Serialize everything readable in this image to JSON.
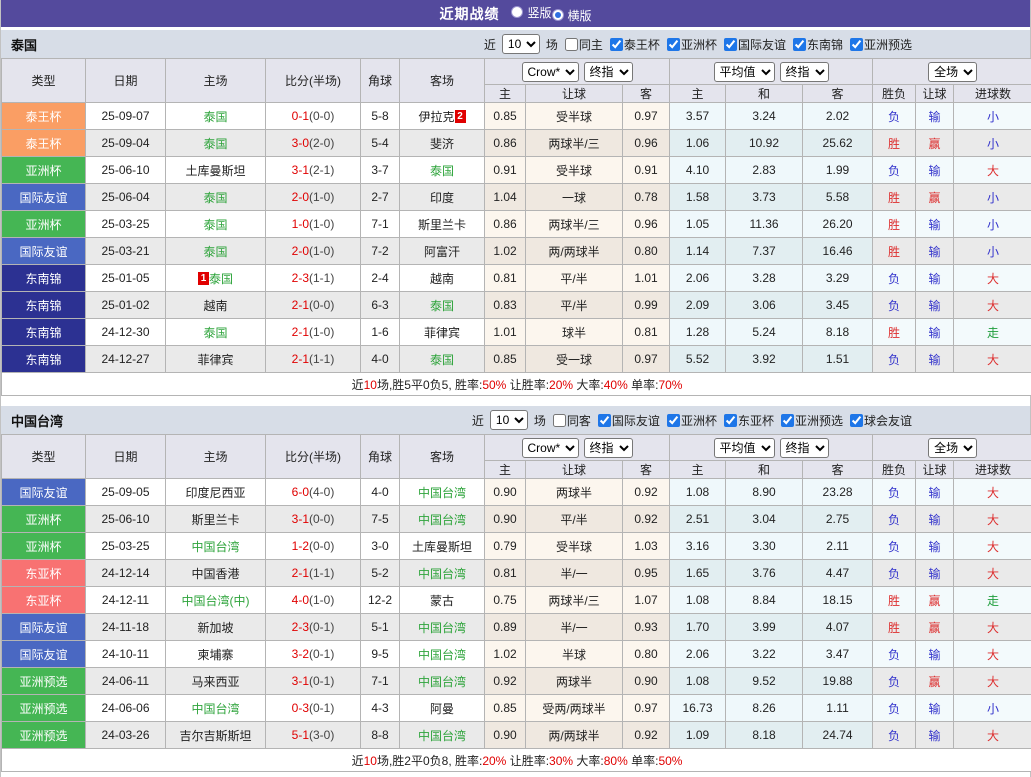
{
  "topbar": {
    "title": "近期战绩",
    "radios": [
      {
        "label": "竖版",
        "checked": false
      },
      {
        "label": "横版",
        "checked": true
      }
    ]
  },
  "table_header": {
    "group_cols": [
      "类型",
      "日期",
      "主场",
      "比分(半场)",
      "角球",
      "客场"
    ],
    "sub_cols": [
      "主",
      "让球",
      "客",
      "主",
      "和",
      "客",
      "胜负",
      "让球",
      "进球数"
    ],
    "selects": {
      "bookmaker": "Crow*",
      "final1": "终指",
      "average": "平均值",
      "final2": "终指",
      "scope": "全场"
    }
  },
  "league_colors": {
    "泰王杯": "#FA9E64",
    "亚洲杯": "#45B654",
    "国际友谊": "#4A68C2",
    "东南锦": "#2C3192",
    "东亚杯": "#F87272",
    "亚洲预选": "#45B654"
  },
  "result_colors": {
    "胜": "#DD2F2F",
    "赢": "#DD2F2F",
    "大": "#DD2F2F",
    "负": "#3333CC",
    "输": "#3333CC",
    "小": "#3333CC",
    "走": "#1F9E3C"
  },
  "sections": [
    {
      "label": "泰国",
      "filters": {
        "prefix": "近",
        "count": "10",
        "suffix": "场",
        "same_option": {
          "label": "同主",
          "checked": false
        },
        "leagues": [
          {
            "label": "泰王杯",
            "checked": true
          },
          {
            "label": "亚洲杯",
            "checked": true
          },
          {
            "label": "国际友谊",
            "checked": true
          },
          {
            "label": "东南锦",
            "checked": true
          },
          {
            "label": "亚洲预选",
            "checked": true
          }
        ]
      },
      "rows": [
        {
          "league": "泰王杯",
          "date": "25-09-07",
          "home": {
            "text": "泰国",
            "green": true,
            "rank": ""
          },
          "score": "0-1",
          "half": "(0-0)",
          "corner": "5-8",
          "away": {
            "text": "伊拉克",
            "green": false,
            "rank": "2"
          },
          "crow": [
            "0.85",
            "受半球",
            "0.97"
          ],
          "avg": [
            "3.57",
            "3.24",
            "2.02"
          ],
          "res": [
            "负",
            "输",
            "小"
          ]
        },
        {
          "league": "泰王杯",
          "date": "25-09-04",
          "home": {
            "text": "泰国",
            "green": true,
            "rank": ""
          },
          "score": "3-0",
          "half": "(2-0)",
          "corner": "5-4",
          "away": {
            "text": "斐济",
            "green": false,
            "rank": ""
          },
          "crow": [
            "0.86",
            "两球半/三",
            "0.96"
          ],
          "avg": [
            "1.06",
            "10.92",
            "25.62"
          ],
          "res": [
            "胜",
            "赢",
            "小"
          ]
        },
        {
          "league": "亚洲杯",
          "date": "25-06-10",
          "home": {
            "text": "土库曼斯坦",
            "green": false,
            "rank": ""
          },
          "score": "3-1",
          "half": "(2-1)",
          "corner": "3-7",
          "away": {
            "text": "泰国",
            "green": true,
            "rank": ""
          },
          "crow": [
            "0.91",
            "受半球",
            "0.91"
          ],
          "avg": [
            "4.10",
            "2.83",
            "1.99"
          ],
          "res": [
            "负",
            "输",
            "大"
          ]
        },
        {
          "league": "国际友谊",
          "date": "25-06-04",
          "home": {
            "text": "泰国",
            "green": true,
            "rank": ""
          },
          "score": "2-0",
          "half": "(1-0)",
          "corner": "2-7",
          "away": {
            "text": "印度",
            "green": false,
            "rank": ""
          },
          "crow": [
            "1.04",
            "一球",
            "0.78"
          ],
          "avg": [
            "1.58",
            "3.73",
            "5.58"
          ],
          "res": [
            "胜",
            "赢",
            "小"
          ]
        },
        {
          "league": "亚洲杯",
          "date": "25-03-25",
          "home": {
            "text": "泰国",
            "green": true,
            "rank": ""
          },
          "score": "1-0",
          "half": "(1-0)",
          "corner": "7-1",
          "away": {
            "text": "斯里兰卡",
            "green": false,
            "rank": ""
          },
          "crow": [
            "0.86",
            "两球半/三",
            "0.96"
          ],
          "avg": [
            "1.05",
            "11.36",
            "26.20"
          ],
          "res": [
            "胜",
            "输",
            "小"
          ]
        },
        {
          "league": "国际友谊",
          "date": "25-03-21",
          "home": {
            "text": "泰国",
            "green": true,
            "rank": ""
          },
          "score": "2-0",
          "half": "(1-0)",
          "corner": "7-2",
          "away": {
            "text": "阿富汗",
            "green": false,
            "rank": ""
          },
          "crow": [
            "1.02",
            "两/两球半",
            "0.80"
          ],
          "avg": [
            "1.14",
            "7.37",
            "16.46"
          ],
          "res": [
            "胜",
            "输",
            "小"
          ]
        },
        {
          "league": "东南锦",
          "date": "25-01-05",
          "home": {
            "text": "泰国",
            "green": true,
            "rank": "1"
          },
          "score": "2-3",
          "half": "(1-1)",
          "corner": "2-4",
          "away": {
            "text": "越南",
            "green": false,
            "rank": ""
          },
          "crow": [
            "0.81",
            "平/半",
            "1.01"
          ],
          "avg": [
            "2.06",
            "3.28",
            "3.29"
          ],
          "res": [
            "负",
            "输",
            "大"
          ]
        },
        {
          "league": "东南锦",
          "date": "25-01-02",
          "home": {
            "text": "越南",
            "green": false,
            "rank": ""
          },
          "score": "2-1",
          "half": "(0-0)",
          "corner": "6-3",
          "away": {
            "text": "泰国",
            "green": true,
            "rank": ""
          },
          "crow": [
            "0.83",
            "平/半",
            "0.99"
          ],
          "avg": [
            "2.09",
            "3.06",
            "3.45"
          ],
          "res": [
            "负",
            "输",
            "大"
          ]
        },
        {
          "league": "东南锦",
          "date": "24-12-30",
          "home": {
            "text": "泰国",
            "green": true,
            "rank": ""
          },
          "score": "2-1",
          "half": "(1-0)",
          "corner": "1-6",
          "away": {
            "text": "菲律宾",
            "green": false,
            "rank": ""
          },
          "crow": [
            "1.01",
            "球半",
            "0.81"
          ],
          "avg": [
            "1.28",
            "5.24",
            "8.18"
          ],
          "res": [
            "胜",
            "输",
            "走"
          ]
        },
        {
          "league": "东南锦",
          "date": "24-12-27",
          "home": {
            "text": "菲律宾",
            "green": false,
            "rank": ""
          },
          "score": "2-1",
          "half": "(1-1)",
          "corner": "4-0",
          "away": {
            "text": "泰国",
            "green": true,
            "rank": ""
          },
          "crow": [
            "0.85",
            "受一球",
            "0.97"
          ],
          "avg": [
            "5.52",
            "3.92",
            "1.51"
          ],
          "res": [
            "负",
            "输",
            "大"
          ]
        }
      ],
      "summary": [
        {
          "text": "近",
          "red": false
        },
        {
          "text": "10",
          "red": true
        },
        {
          "text": "场,胜5平0负5, 胜率:",
          "red": false
        },
        {
          "text": "50%",
          "red": true
        },
        {
          "text": " 让胜率:",
          "red": false
        },
        {
          "text": "20%",
          "red": true
        },
        {
          "text": " 大率:",
          "red": false
        },
        {
          "text": "40%",
          "red": true
        },
        {
          "text": " 单率:",
          "red": false
        },
        {
          "text": "70%",
          "red": true
        }
      ]
    },
    {
      "label": "中国台湾",
      "filters": {
        "prefix": "近",
        "count": "10",
        "suffix": "场",
        "same_option": {
          "label": "同客",
          "checked": false
        },
        "leagues": [
          {
            "label": "国际友谊",
            "checked": true
          },
          {
            "label": "亚洲杯",
            "checked": true
          },
          {
            "label": "东亚杯",
            "checked": true
          },
          {
            "label": "亚洲预选",
            "checked": true
          },
          {
            "label": "球会友谊",
            "checked": true
          }
        ]
      },
      "rows": [
        {
          "league": "国际友谊",
          "date": "25-09-05",
          "home": {
            "text": "印度尼西亚",
            "green": false,
            "rank": ""
          },
          "score": "6-0",
          "half": "(4-0)",
          "corner": "4-0",
          "away": {
            "text": "中国台湾",
            "green": true,
            "rank": ""
          },
          "crow": [
            "0.90",
            "两球半",
            "0.92"
          ],
          "avg": [
            "1.08",
            "8.90",
            "23.28"
          ],
          "res": [
            "负",
            "输",
            "大"
          ]
        },
        {
          "league": "亚洲杯",
          "date": "25-06-10",
          "home": {
            "text": "斯里兰卡",
            "green": false,
            "rank": ""
          },
          "score": "3-1",
          "half": "(0-0)",
          "corner": "7-5",
          "away": {
            "text": "中国台湾",
            "green": true,
            "rank": ""
          },
          "crow": [
            "0.90",
            "平/半",
            "0.92"
          ],
          "avg": [
            "2.51",
            "3.04",
            "2.75"
          ],
          "res": [
            "负",
            "输",
            "大"
          ]
        },
        {
          "league": "亚洲杯",
          "date": "25-03-25",
          "home": {
            "text": "中国台湾",
            "green": true,
            "rank": ""
          },
          "score": "1-2",
          "half": "(0-0)",
          "corner": "3-0",
          "away": {
            "text": "土库曼斯坦",
            "green": false,
            "rank": ""
          },
          "crow": [
            "0.79",
            "受半球",
            "1.03"
          ],
          "avg": [
            "3.16",
            "3.30",
            "2.11"
          ],
          "res": [
            "负",
            "输",
            "大"
          ]
        },
        {
          "league": "东亚杯",
          "date": "24-12-14",
          "home": {
            "text": "中国香港",
            "green": false,
            "rank": ""
          },
          "score": "2-1",
          "half": "(1-1)",
          "corner": "5-2",
          "away": {
            "text": "中国台湾",
            "green": true,
            "rank": ""
          },
          "crow": [
            "0.81",
            "半/一",
            "0.95"
          ],
          "avg": [
            "1.65",
            "3.76",
            "4.47"
          ],
          "res": [
            "负",
            "输",
            "大"
          ]
        },
        {
          "league": "东亚杯",
          "date": "24-12-11",
          "home": {
            "text": "中国台湾(中)",
            "green": true,
            "rank": ""
          },
          "score": "4-0",
          "half": "(1-0)",
          "corner": "12-2",
          "away": {
            "text": "蒙古",
            "green": false,
            "rank": ""
          },
          "crow": [
            "0.75",
            "两球半/三",
            "1.07"
          ],
          "avg": [
            "1.08",
            "8.84",
            "18.15"
          ],
          "res": [
            "胜",
            "赢",
            "走"
          ]
        },
        {
          "league": "国际友谊",
          "date": "24-11-18",
          "home": {
            "text": "新加坡",
            "green": false,
            "rank": ""
          },
          "score": "2-3",
          "half": "(0-1)",
          "corner": "5-1",
          "away": {
            "text": "中国台湾",
            "green": true,
            "rank": ""
          },
          "crow": [
            "0.89",
            "半/一",
            "0.93"
          ],
          "avg": [
            "1.70",
            "3.99",
            "4.07"
          ],
          "res": [
            "胜",
            "赢",
            "大"
          ]
        },
        {
          "league": "国际友谊",
          "date": "24-10-11",
          "home": {
            "text": "柬埔寨",
            "green": false,
            "rank": ""
          },
          "score": "3-2",
          "half": "(0-1)",
          "corner": "9-5",
          "away": {
            "text": "中国台湾",
            "green": true,
            "rank": ""
          },
          "crow": [
            "1.02",
            "半球",
            "0.80"
          ],
          "avg": [
            "2.06",
            "3.22",
            "3.47"
          ],
          "res": [
            "负",
            "输",
            "大"
          ]
        },
        {
          "league": "亚洲预选",
          "date": "24-06-11",
          "home": {
            "text": "马来西亚",
            "green": false,
            "rank": ""
          },
          "score": "3-1",
          "half": "(0-1)",
          "corner": "7-1",
          "away": {
            "text": "中国台湾",
            "green": true,
            "rank": ""
          },
          "crow": [
            "0.92",
            "两球半",
            "0.90"
          ],
          "avg": [
            "1.08",
            "9.52",
            "19.88"
          ],
          "res": [
            "负",
            "赢",
            "大"
          ]
        },
        {
          "league": "亚洲预选",
          "date": "24-06-06",
          "home": {
            "text": "中国台湾",
            "green": true,
            "rank": ""
          },
          "score": "0-3",
          "half": "(0-1)",
          "corner": "4-3",
          "away": {
            "text": "阿曼",
            "green": false,
            "rank": ""
          },
          "crow": [
            "0.85",
            "受两/两球半",
            "0.97"
          ],
          "avg": [
            "16.73",
            "8.26",
            "1.11"
          ],
          "res": [
            "负",
            "输",
            "小"
          ]
        },
        {
          "league": "亚洲预选",
          "date": "24-03-26",
          "home": {
            "text": "吉尔吉斯斯坦",
            "green": false,
            "rank": ""
          },
          "score": "5-1",
          "half": "(3-0)",
          "corner": "8-8",
          "away": {
            "text": "中国台湾",
            "green": true,
            "rank": ""
          },
          "crow": [
            "0.90",
            "两/两球半",
            "0.92"
          ],
          "avg": [
            "1.09",
            "8.18",
            "24.74"
          ],
          "res": [
            "负",
            "输",
            "大"
          ]
        }
      ],
      "summary": [
        {
          "text": "近",
          "red": false
        },
        {
          "text": "10",
          "red": true
        },
        {
          "text": "场,胜2平0负8, 胜率:",
          "red": false
        },
        {
          "text": "20%",
          "red": true
        },
        {
          "text": " 让胜率:",
          "red": false
        },
        {
          "text": "30%",
          "red": true
        },
        {
          "text": " 大率:",
          "red": false
        },
        {
          "text": "80%",
          "red": true
        },
        {
          "text": " 单率:",
          "red": false
        },
        {
          "text": "50%",
          "red": true
        }
      ]
    }
  ]
}
